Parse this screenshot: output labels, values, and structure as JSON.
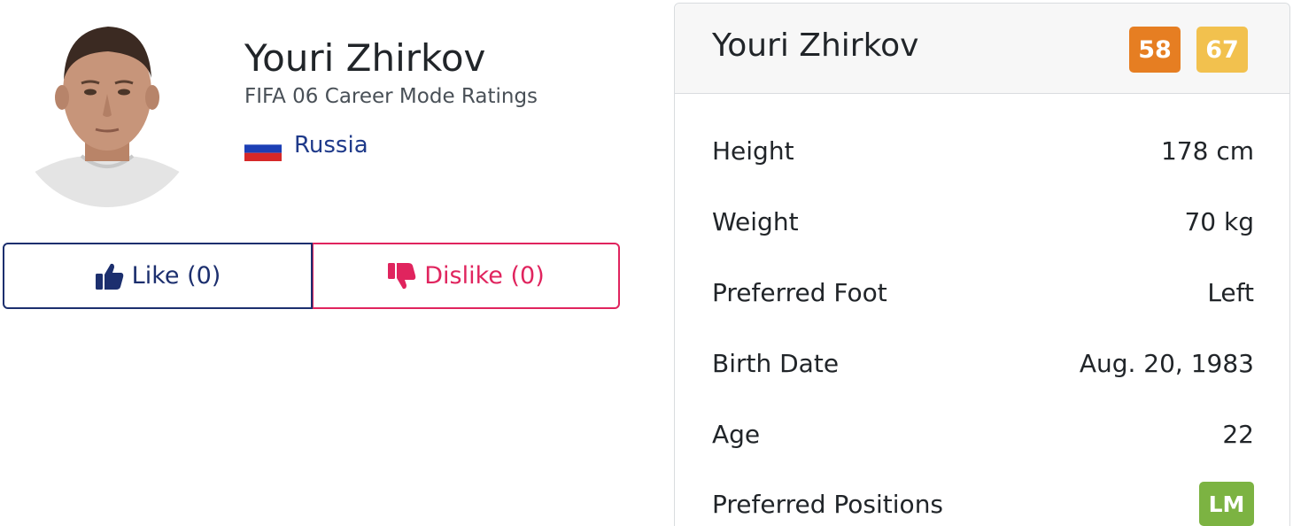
{
  "player": {
    "name": "Youri Zhirkov",
    "subtitle": "FIFA 06 Career Mode Ratings",
    "nation": "Russia"
  },
  "votes": {
    "like_label": "Like (0)",
    "dislike_label": "Dislike (0)"
  },
  "card": {
    "title": "Youri Zhirkov",
    "overall_rating": "58",
    "potential_rating": "67",
    "attributes": [
      {
        "label": "Height",
        "value": "178 cm"
      },
      {
        "label": "Weight",
        "value": "70 kg"
      },
      {
        "label": "Preferred Foot",
        "value": "Left"
      },
      {
        "label": "Birth Date",
        "value": "Aug. 20, 1983"
      },
      {
        "label": "Age",
        "value": "22"
      },
      {
        "label": "Preferred Positions",
        "value": "LM"
      }
    ]
  },
  "colors": {
    "overall_badge": "#e67e22",
    "potential_badge": "#f2c14e",
    "position_badge": "#7cb342",
    "like": "#1c2f6e",
    "dislike": "#e0245e",
    "nation_text": "#1f3a8a"
  },
  "icons": {
    "like": "thumbs-up-icon",
    "dislike": "thumbs-down-icon",
    "flag": "russia-flag-icon"
  }
}
